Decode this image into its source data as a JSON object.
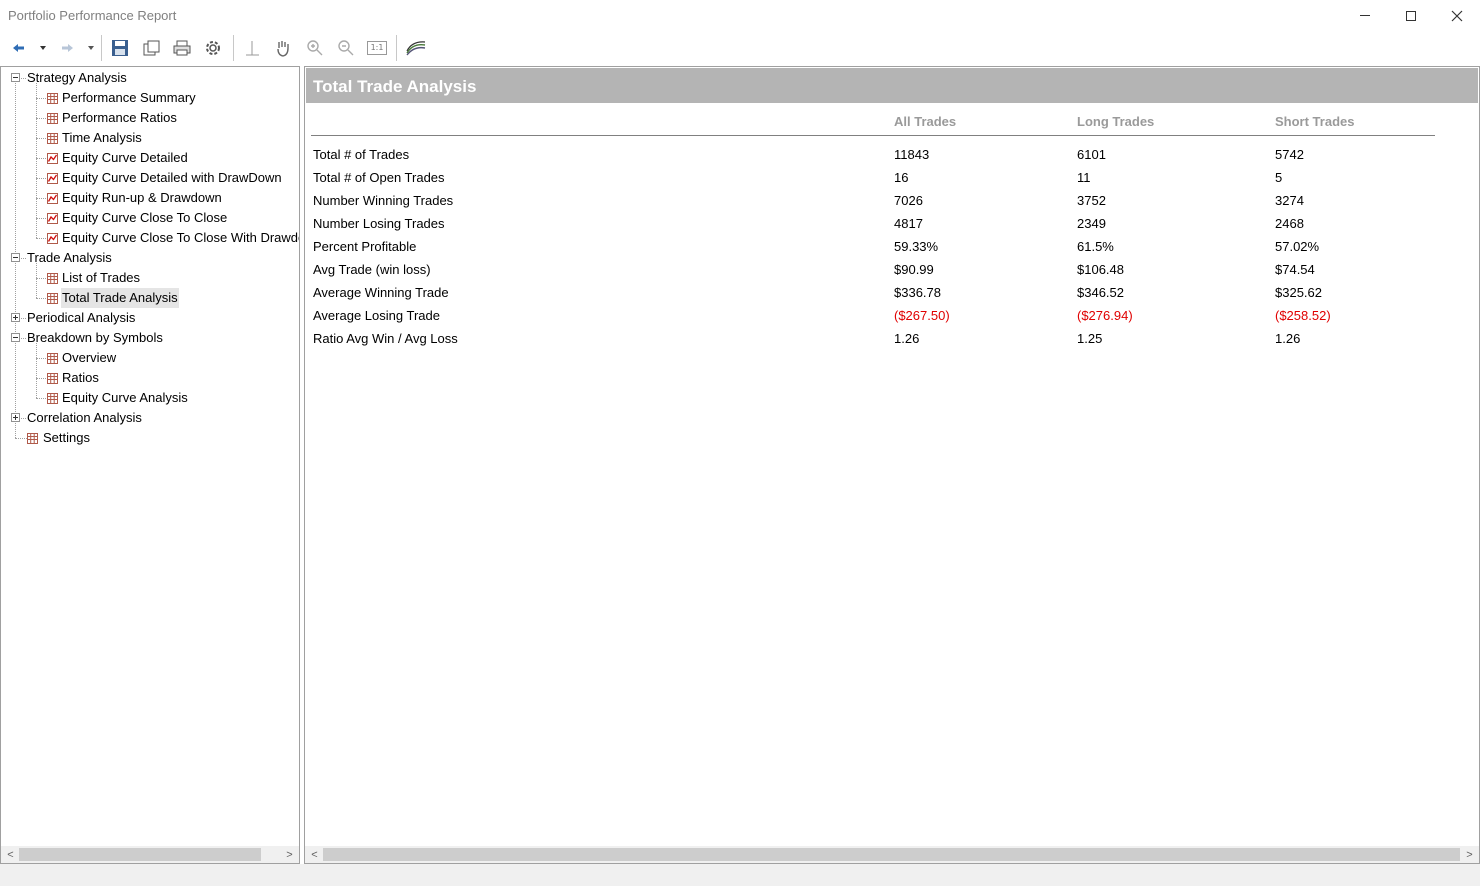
{
  "window": {
    "title": "Portfolio Performance Report"
  },
  "toolbar": {
    "buttons": [
      {
        "name": "back",
        "icon": "arrow-left-icon"
      },
      {
        "name": "back-dropdown",
        "icon": "chevron-down-icon"
      },
      {
        "name": "forward",
        "icon": "arrow-right-icon"
      },
      {
        "name": "forward-dropdown",
        "icon": "chevron-down-icon"
      },
      {
        "name": "save",
        "icon": "save-icon"
      },
      {
        "name": "page-setup",
        "icon": "page-setup-icon"
      },
      {
        "name": "print",
        "icon": "print-icon"
      },
      {
        "name": "settings",
        "icon": "gear-icon"
      },
      {
        "name": "crosshair",
        "icon": "crosshair-icon"
      },
      {
        "name": "pan",
        "icon": "hand-icon"
      },
      {
        "name": "zoom-in",
        "icon": "zoom-in-icon"
      },
      {
        "name": "zoom-out",
        "icon": "zoom-out-icon"
      },
      {
        "name": "actual-size",
        "icon": "actual-size-icon",
        "label": "1:1"
      },
      {
        "name": "chart-style",
        "icon": "chart-lines-icon"
      }
    ]
  },
  "tree": {
    "items": [
      {
        "label": "Strategy Analysis",
        "level": 0,
        "expanded": true
      },
      {
        "label": "Performance Summary",
        "level": 1,
        "icon": "table-icon"
      },
      {
        "label": "Performance Ratios",
        "level": 1,
        "icon": "table-icon"
      },
      {
        "label": "Time Analysis",
        "level": 1,
        "icon": "table-icon"
      },
      {
        "label": "Equity Curve Detailed",
        "level": 1,
        "icon": "chart-icon"
      },
      {
        "label": "Equity Curve Detailed with DrawDown",
        "level": 1,
        "icon": "chart-icon"
      },
      {
        "label": "Equity Run-up & Drawdown",
        "level": 1,
        "icon": "chart-icon"
      },
      {
        "label": "Equity Curve Close To Close",
        "level": 1,
        "icon": "chart-icon"
      },
      {
        "label": "Equity Curve Close To Close With Drawdo",
        "level": 1,
        "icon": "chart-icon"
      },
      {
        "label": "Trade Analysis",
        "level": 0,
        "expanded": true
      },
      {
        "label": "List of Trades",
        "level": 1,
        "icon": "table-icon"
      },
      {
        "label": "Total Trade Analysis",
        "level": 1,
        "icon": "table-icon",
        "selected": true
      },
      {
        "label": "Periodical Analysis",
        "level": 0,
        "expanded": false
      },
      {
        "label": "Breakdown by Symbols",
        "level": 0,
        "expanded": true
      },
      {
        "label": "Overview",
        "level": 1,
        "icon": "table-icon"
      },
      {
        "label": "Ratios",
        "level": 1,
        "icon": "table-icon"
      },
      {
        "label": "Equity Curve Analysis",
        "level": 1,
        "icon": "table-icon"
      },
      {
        "label": "Correlation Analysis",
        "level": 0,
        "expanded": false
      },
      {
        "label": "Settings",
        "level": 0,
        "icon": "table-icon"
      }
    ]
  },
  "report": {
    "title": "Total Trade Analysis",
    "columns": [
      "All Trades",
      "Long Trades",
      "Short Trades"
    ],
    "rows": [
      {
        "label": "Total # of Trades",
        "values": [
          "11843",
          "6101",
          "5742"
        ],
        "negative": false
      },
      {
        "label": "Total # of Open Trades",
        "values": [
          "16",
          "11",
          "5"
        ],
        "negative": false
      },
      {
        "label": "Number Winning Trades",
        "values": [
          "7026",
          "3752",
          "3274"
        ],
        "negative": false
      },
      {
        "label": "Number Losing Trades",
        "values": [
          "4817",
          "2349",
          "2468"
        ],
        "negative": false
      },
      {
        "label": "Percent Profitable",
        "values": [
          "59.33%",
          "61.5%",
          "57.02%"
        ],
        "negative": false
      },
      {
        "label": "Avg Trade (win  loss)",
        "values": [
          "$90.99",
          "$106.48",
          "$74.54"
        ],
        "negative": false
      },
      {
        "label": "Average Winning Trade",
        "values": [
          "$336.78",
          "$346.52",
          "$325.62"
        ],
        "negative": false
      },
      {
        "label": "Average Losing Trade",
        "values": [
          "($267.50)",
          "($276.94)",
          "($258.52)"
        ],
        "negative": true
      },
      {
        "label": "Ratio Avg Win / Avg Loss",
        "values": [
          "1.26",
          "1.25",
          "1.26"
        ],
        "negative": false
      }
    ]
  },
  "colors": {
    "negative": "#e00000",
    "header_bg": "#b4b4b4",
    "column_header": "#9a9a9a"
  }
}
